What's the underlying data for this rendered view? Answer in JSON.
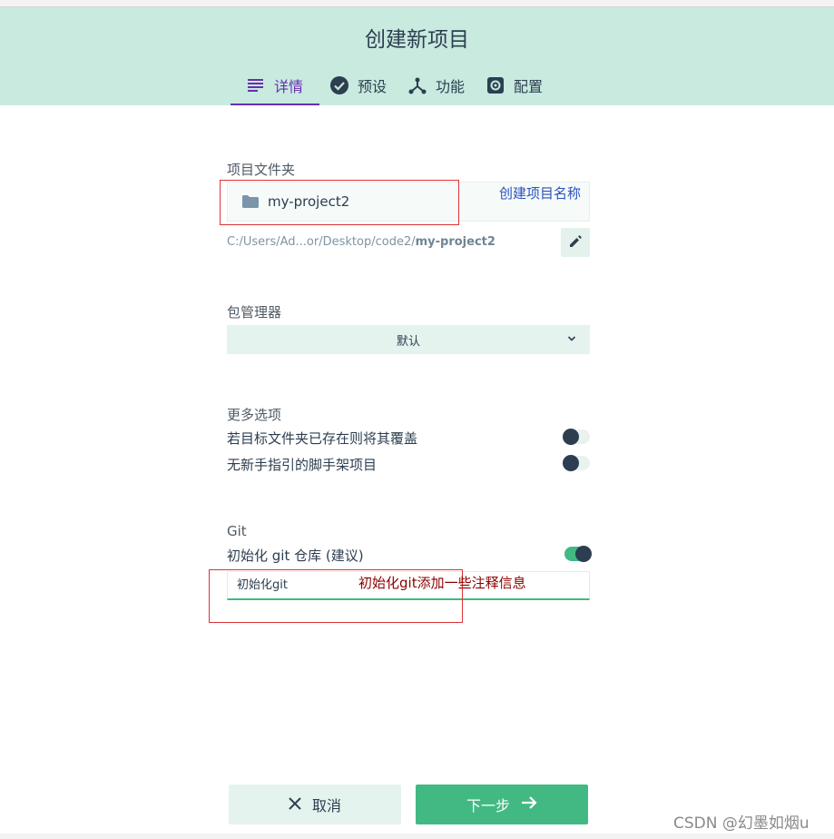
{
  "header": {
    "title": "创建新项目",
    "tabs": [
      {
        "label": "详情",
        "icon": "list-icon",
        "active": true
      },
      {
        "label": "预设",
        "icon": "check-circle-icon",
        "active": false
      },
      {
        "label": "功能",
        "icon": "fork-icon",
        "active": false
      },
      {
        "label": "配置",
        "icon": "gear-icon",
        "active": false
      }
    ]
  },
  "project_folder": {
    "label": "项目文件夹",
    "value": "my-project2",
    "path_prefix": "C:/Users/Ad...or/Desktop/code2/",
    "path_name": "my-project2"
  },
  "package_manager": {
    "label": "包管理器",
    "selected": "默认"
  },
  "more_options": {
    "label": "更多选项",
    "items": [
      {
        "label": "若目标文件夹已存在则将其覆盖",
        "enabled": false
      },
      {
        "label": "无新手指引的脚手架项目",
        "enabled": false
      }
    ]
  },
  "git": {
    "label": "Git",
    "init_label": "初始化 git 仓库 (建议)",
    "init_enabled": true,
    "commit_message": "初始化git"
  },
  "annotations": {
    "project_name_note": "创建项目名称",
    "git_note": "初始化git添加一些注释信息",
    "note_color_blue": "#2a52be",
    "note_color_red": "#8b0000"
  },
  "footer": {
    "cancel_label": "取消",
    "next_label": "下一步"
  },
  "watermark": "CSDN @幻墨如烟u",
  "colors": {
    "accent": "#42b983",
    "header_bg": "#c8eadf",
    "active_tab": "#6a2fb0",
    "text": "#2c3e50"
  }
}
